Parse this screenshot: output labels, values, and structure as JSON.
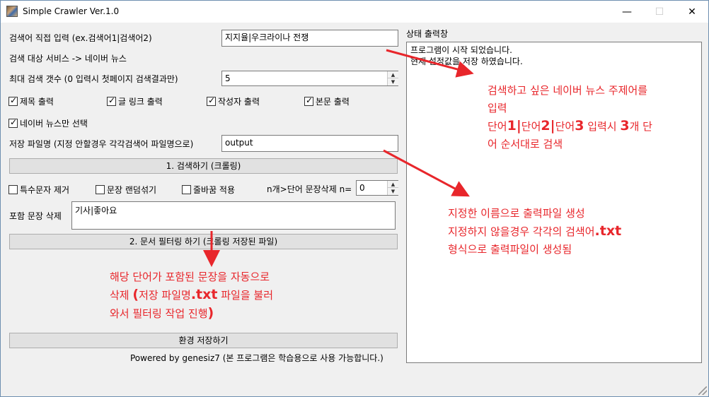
{
  "window": {
    "title": "Simple Crawler Ver.1.0",
    "min_glyph": "—",
    "max_glyph": "☐",
    "close_glyph": "✕"
  },
  "search": {
    "direct_label": "검색어 직접 입력 (ex.검색어1|검색어2)",
    "direct_value": "지지율|우크라이나 전쟁",
    "service_label": "검색 대상 서비스 -> 네이버 뉴스",
    "max_label": "최대 검색 갯수 (0 입력시 첫페이지 검색결과만)",
    "max_value": "5"
  },
  "options": {
    "title_out": "제목 출력",
    "link_out": "글 링크 출력",
    "author_out": "작성자 출력",
    "body_out": "본문 출력",
    "naver_only": "네이버 뉴스만 선택"
  },
  "save": {
    "label": "저장 파일명 (지정 안할경우 각각검색어 파일명으로)",
    "value": "output",
    "crawl_button": "1. 검색하기 (크롤링)"
  },
  "filter": {
    "special_chars": "특수문자 제거",
    "shuffle": "문장 랜덤섞기",
    "linebreak": "줄바꿈 적용",
    "word_delete_label": "n개>단어 문장삭제 n=",
    "word_delete_value": "0",
    "contain_label": "포함 문장 삭제",
    "contain_value": "기사|좋아요",
    "filter_button": "2. 문서 필터링 하기 (크롤링 저장된 파일)"
  },
  "footer": {
    "save_env_button": "환경 저장하기",
    "powered": "Powered by genesiz7 (본 프로그램은 학습용으로 사용 가능합니다.)"
  },
  "log": {
    "label": "상태 출력창",
    "lines": [
      "프로그램이 시작 되었습니다.",
      "현재 설정값을 저장 하였습니다."
    ]
  },
  "annotations": {
    "a1_l1": "검색하고 싶은 네이버 뉴스 주제어를",
    "a1_l2": "입력",
    "a1_l3a": "단어",
    "a1_n1": "1",
    "a1_bar1": "|",
    "a1_l3b": "단어",
    "a1_n2": "2",
    "a1_bar2": "|",
    "a1_l3c": "단어",
    "a1_n3": "3",
    "a1_l3d": " 입력시 ",
    "a1_n4": "3",
    "a1_l3e": "개 단",
    "a1_l4": "어 순서대로 검색",
    "a2_l1": "지정한 이름으로 출력파일 생성",
    "a2_l2a": "지정하지 않을경우 각각의 검색어",
    "a2_l2b": ".txt",
    "a2_l3": "형식으로 출력파일이 생성됨",
    "a3_l1": "해당 단어가 포함된 문장을 자동으로",
    "a3_l2a": "삭제 ",
    "a3_paren_open": "(",
    "a3_l2b": "저장 파일명",
    "a3_l2c": ".txt",
    "a3_l2d": " 파일을 불러",
    "a3_l3a": "와서 필터링 작업 진행",
    "a3_paren_close": ")"
  },
  "colors": {
    "annotation": "#e8262b",
    "background": "#f0f0f0"
  }
}
